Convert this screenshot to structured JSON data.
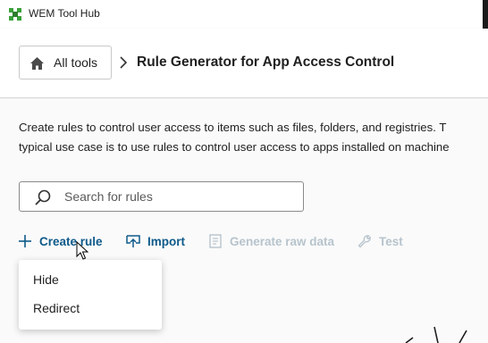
{
  "window": {
    "title": "WEM Tool Hub"
  },
  "breadcrumb": {
    "home_label": "All tools",
    "current": "Rule Generator for App Access Control"
  },
  "description": {
    "line1": "Create rules to control user access to items such as files, folders, and registries. T",
    "line2": "typical use case is to use rules to control user access to apps installed on machine"
  },
  "search": {
    "placeholder": "Search for rules",
    "value": ""
  },
  "toolbar": {
    "create_label": "Create rule",
    "import_label": "Import",
    "generate_label": "Generate raw data",
    "test_label": "Test"
  },
  "create_menu": {
    "options": [
      "Hide",
      "Redirect"
    ]
  },
  "colors": {
    "accent": "#0e5a8a",
    "disabled": "#b7c4cd",
    "app_icon": "#3aa23a"
  },
  "icons": {
    "app": "wem-logo-icon",
    "home": "home-icon",
    "separator": "chevron-right-icon",
    "search": "search-icon",
    "create": "plus-icon",
    "import": "import-icon",
    "generate": "document-icon",
    "test": "wrench-icon"
  }
}
